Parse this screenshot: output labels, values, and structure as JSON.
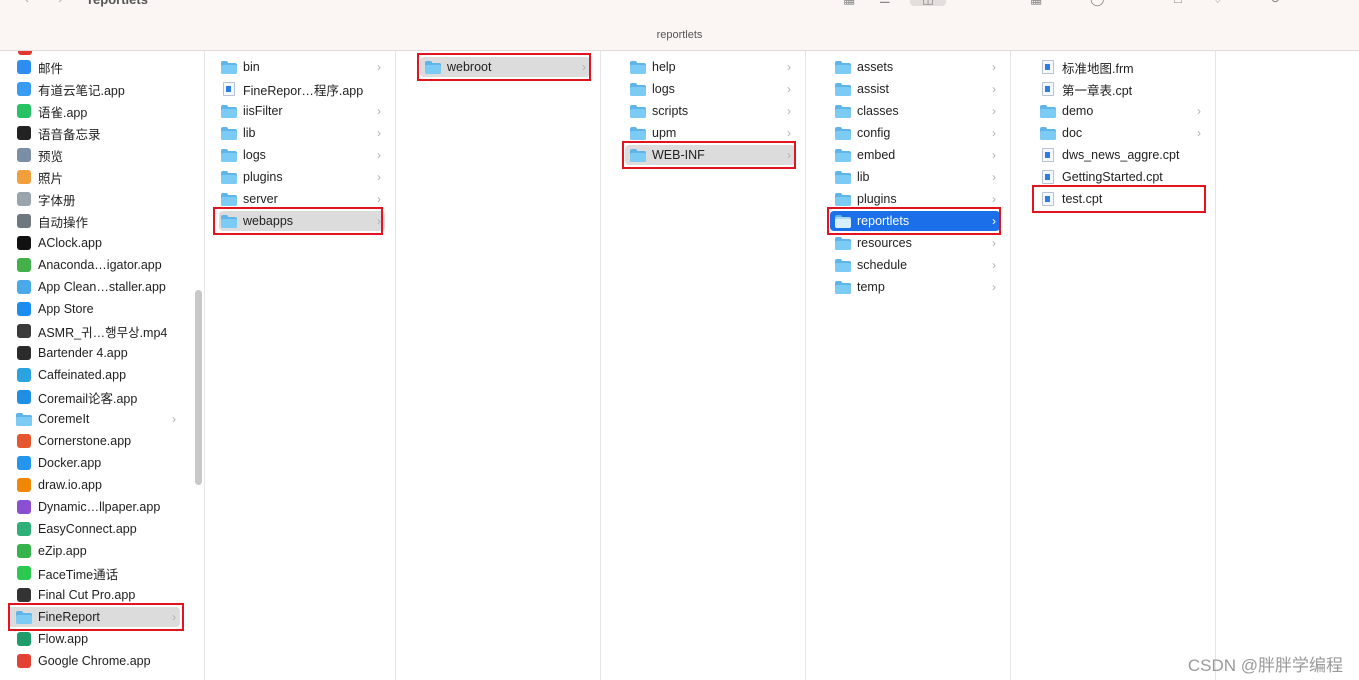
{
  "window": {
    "title": "reportlets",
    "path_label": "reportlets"
  },
  "toolbar": {
    "back_glyph": "‹",
    "forward_glyph": "›",
    "icons": [
      "icon-view-icon",
      "list-view-icon",
      "column-view-icon",
      "gallery-view-icon",
      "group-icon",
      "share-icon",
      "tag-icon",
      "more-icon"
    ]
  },
  "sidebar": {
    "items": [
      {
        "label": "邮件",
        "icon": "mail-icon",
        "color": "#2f8df0"
      },
      {
        "label": "有道云笔记.app",
        "icon": "youdao-note-icon",
        "color": "#3a9bf3"
      },
      {
        "label": "语雀.app",
        "icon": "yuque-icon",
        "color": "#27c264"
      },
      {
        "label": "语音备忘录",
        "icon": "voice-memos-icon",
        "color": "#222222"
      },
      {
        "label": "预览",
        "icon": "preview-icon",
        "color": "#7a8fa5"
      },
      {
        "label": "照片",
        "icon": "photos-icon",
        "color": "#f2a03d"
      },
      {
        "label": "字体册",
        "icon": "font-book-icon",
        "color": "#9aa4ad"
      },
      {
        "label": "自动操作",
        "icon": "automator-icon",
        "color": "#6e7680"
      },
      {
        "label": "AClock.app",
        "icon": "aclock-icon",
        "color": "#111111"
      },
      {
        "label": "Anaconda…igator.app",
        "icon": "anaconda-icon",
        "color": "#43b049"
      },
      {
        "label": "App Clean…staller.app",
        "icon": "app-cleaner-icon",
        "color": "#4aa9e8"
      },
      {
        "label": "App Store",
        "icon": "app-store-icon",
        "color": "#1d8cf0"
      },
      {
        "label": "ASMR_귀…행무상.mp4",
        "icon": "video-file-icon",
        "color": "#3a3a3a"
      },
      {
        "label": "Bartender 4.app",
        "icon": "bartender-icon",
        "color": "#2b2b2b"
      },
      {
        "label": "Caffeinated.app",
        "icon": "caffeinated-icon",
        "color": "#2aa3e0"
      },
      {
        "label": "Coremail论客.app",
        "icon": "coremail-icon",
        "color": "#1f8fe3"
      },
      {
        "label": "CoremeIt",
        "icon": "folder-icon",
        "folder": true,
        "chevron": true
      },
      {
        "label": "Cornerstone.app",
        "icon": "cornerstone-icon",
        "color": "#e6562f"
      },
      {
        "label": "Docker.app",
        "icon": "docker-icon",
        "color": "#2496ed"
      },
      {
        "label": "draw.io.app",
        "icon": "drawio-icon",
        "color": "#f08705"
      },
      {
        "label": "Dynamic…llpaper.app",
        "icon": "dynamic-wallpaper-icon",
        "color": "#8b4fd1"
      },
      {
        "label": "EasyConnect.app",
        "icon": "easyconnect-icon",
        "color": "#2fb07a"
      },
      {
        "label": "eZip.app",
        "icon": "ezip-icon",
        "color": "#36b34a"
      },
      {
        "label": "FaceTime通话",
        "icon": "facetime-icon",
        "color": "#2bc94f"
      },
      {
        "label": "Final Cut Pro.app",
        "icon": "final-cut-icon",
        "color": "#333333"
      },
      {
        "label": "FineReport",
        "icon": "folder-icon",
        "folder": true,
        "chevron": true,
        "selected": "grey",
        "boxed": true
      },
      {
        "label": "Flow.app",
        "icon": "flow-icon",
        "color": "#1e9c6a"
      },
      {
        "label": "Google Chrome.app",
        "icon": "chrome-icon",
        "color": "#e34133"
      }
    ]
  },
  "columns": [
    {
      "name": "finereport-column",
      "items": [
        {
          "label": "bin",
          "folder": true,
          "chevron": true
        },
        {
          "label": "FineRepor…程序.app",
          "folder": false,
          "chevron": false,
          "icon": "uninstaller-app-icon"
        },
        {
          "label": "iisFilter",
          "folder": true,
          "chevron": true
        },
        {
          "label": "lib",
          "folder": true,
          "chevron": true
        },
        {
          "label": "logs",
          "folder": true,
          "chevron": true
        },
        {
          "label": "plugins",
          "folder": true,
          "chevron": true
        },
        {
          "label": "server",
          "folder": true,
          "chevron": true
        },
        {
          "label": "webapps",
          "folder": true,
          "chevron": true,
          "selected": "grey",
          "boxed": true
        }
      ]
    },
    {
      "name": "webapps-column",
      "items": [
        {
          "label": "webroot",
          "folder": true,
          "chevron": true,
          "selected": "grey",
          "boxed": true
        }
      ]
    },
    {
      "name": "webroot-column",
      "items": [
        {
          "label": "help",
          "folder": true,
          "chevron": true
        },
        {
          "label": "logs",
          "folder": true,
          "chevron": true
        },
        {
          "label": "scripts",
          "folder": true,
          "chevron": true
        },
        {
          "label": "upm",
          "folder": true,
          "chevron": true
        },
        {
          "label": "WEB-INF",
          "folder": true,
          "chevron": true,
          "selected": "grey",
          "boxed": true
        }
      ]
    },
    {
      "name": "web-inf-column",
      "items": [
        {
          "label": "assets",
          "folder": true,
          "chevron": true
        },
        {
          "label": "assist",
          "folder": true,
          "chevron": true
        },
        {
          "label": "classes",
          "folder": true,
          "chevron": true
        },
        {
          "label": "config",
          "folder": true,
          "chevron": true
        },
        {
          "label": "embed",
          "folder": true,
          "chevron": true
        },
        {
          "label": "lib",
          "folder": true,
          "chevron": true
        },
        {
          "label": "plugins",
          "folder": true,
          "chevron": true
        },
        {
          "label": "reportlets",
          "folder": true,
          "chevron": true,
          "selected": "blue",
          "boxed": true
        },
        {
          "label": "resources",
          "folder": true,
          "chevron": true
        },
        {
          "label": "schedule",
          "folder": true,
          "chevron": true
        },
        {
          "label": "temp",
          "folder": true,
          "chevron": true
        }
      ]
    },
    {
      "name": "reportlets-column",
      "items": [
        {
          "label": "标准地图.frm",
          "folder": false,
          "chevron": false,
          "icon": "frm-file-icon"
        },
        {
          "label": "第一章表.cpt",
          "folder": false,
          "chevron": false,
          "icon": "cpt-file-icon"
        },
        {
          "label": "demo",
          "folder": true,
          "chevron": true
        },
        {
          "label": "doc",
          "folder": true,
          "chevron": true
        },
        {
          "label": "dws_news_aggre.cpt",
          "folder": false,
          "chevron": false,
          "icon": "cpt-file-icon"
        },
        {
          "label": "GettingStarted.cpt",
          "folder": false,
          "chevron": false,
          "icon": "cpt-file-icon"
        },
        {
          "label": "test.cpt",
          "folder": false,
          "chevron": false,
          "icon": "cpt-file-icon",
          "boxed": true
        }
      ]
    }
  ],
  "watermark": "CSDN @胖胖学编程",
  "colors": {
    "selection_blue": "#1b6fe8",
    "selection_grey": "#dcdcdc",
    "annotation_red": "#e3141f",
    "folder_blue": "#5fb4ea"
  }
}
